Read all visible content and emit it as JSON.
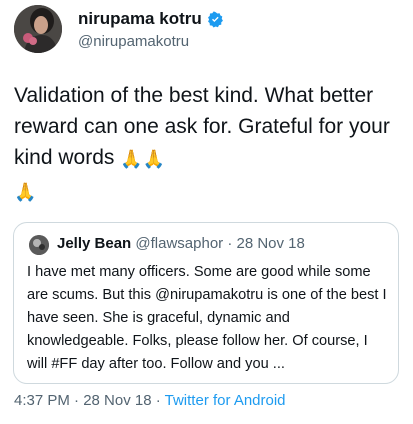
{
  "tweet": {
    "display_name": "nirupama kotru",
    "handle": "@nirupamakotru",
    "text_main": "Validation of the best kind. What better reward can one ask for. Grateful for your kind words",
    "emoji": "🙏",
    "timestamp": "4:37 PM · 28 Nov 18 ·",
    "source": "Twitter for Android"
  },
  "quote": {
    "display_name": "Jelly Bean",
    "meta": "@flawsaphor · 28 Nov 18",
    "text": "I have met many officers. Some are good while some are scums. But this @nirupamakotru is one of the best I have seen. She is graceful, dynamic and knowledgeable. Folks, please follow her. Of course, I will #FF day after too. Follow and you ..."
  },
  "colors": {
    "verified": "#1d9bf0",
    "link": "#1d9bf0",
    "secondary_text": "#536471",
    "border": "#cfd9de"
  },
  "icons": {
    "verified": "verified-badge-icon",
    "emoji": "folded-hands-emoji"
  }
}
